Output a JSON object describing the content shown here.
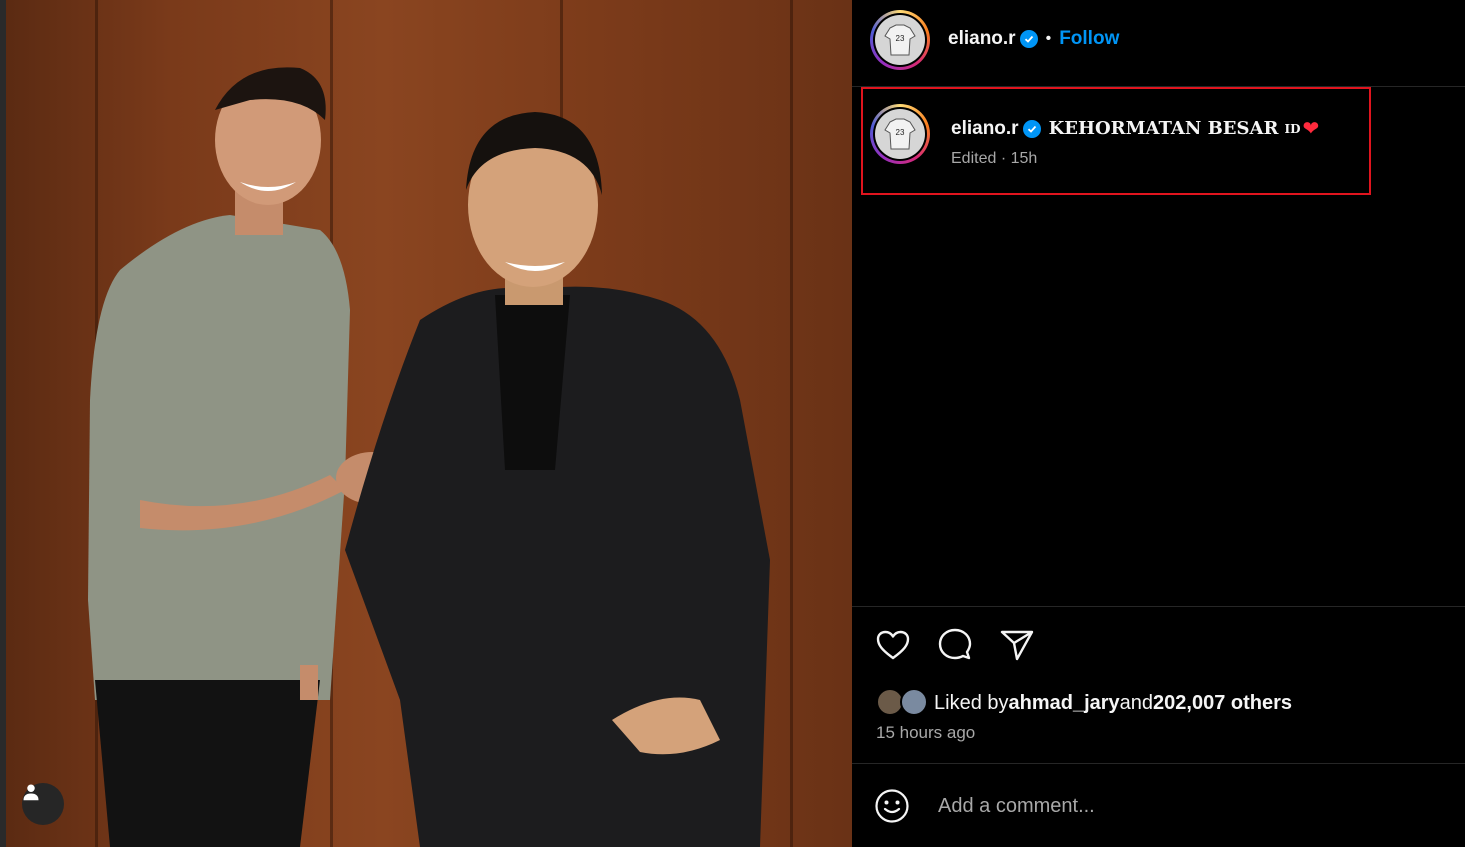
{
  "post": {
    "image_alt": "Two men shaking hands in front of a wooden wall",
    "tag_icon": "user-tag-icon"
  },
  "header": {
    "username": "eliano.r",
    "separator": "•",
    "follow_label": "Follow"
  },
  "caption": {
    "username": "eliano.r",
    "text": "KEHORMATAN BESAR",
    "flag": "ID",
    "heart": "❤",
    "meta": "Edited · 15h"
  },
  "actions": {
    "like_icon": "heart-icon",
    "comment_icon": "comment-icon",
    "share_icon": "send-icon"
  },
  "likes": {
    "prefix": "Liked by ",
    "first_user": "ahmad_jary",
    "connector": " and ",
    "others": "202,007 others",
    "time_ago": "15 hours ago"
  },
  "comment": {
    "placeholder": "Add a comment...",
    "emoji_icon": "emoji-icon"
  },
  "colors": {
    "accent": "#0095f6",
    "highlight_box": "#e0141e",
    "background": "#000000"
  }
}
